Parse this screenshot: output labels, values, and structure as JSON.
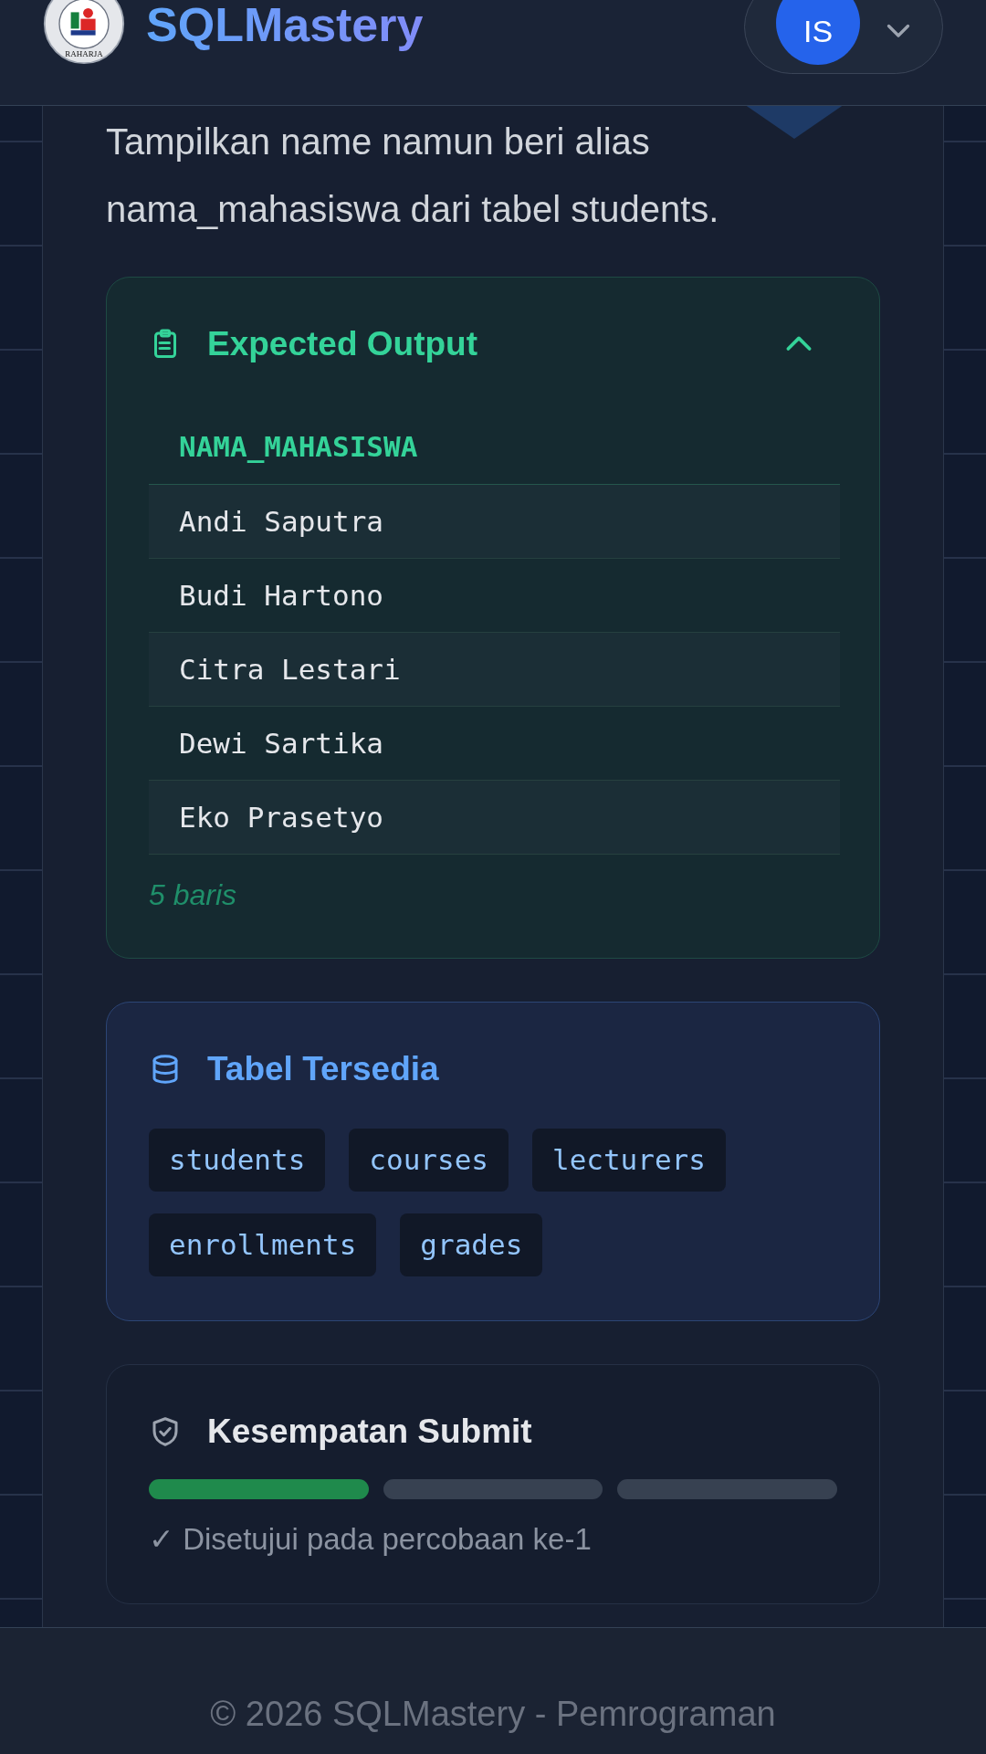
{
  "header": {
    "logo_text": "RAHARJA",
    "title": "SQLMastery",
    "user_initials": "IS"
  },
  "task": {
    "description_lines": [
      "Tampilkan name namun beri alias",
      "nama_mahasiswa dari tabel students."
    ]
  },
  "expected_output": {
    "title": "Expected Output",
    "expanded": true,
    "column": "NAMA_MAHASISWA",
    "rows": [
      "Andi Saputra",
      "Budi Hartono",
      "Citra Lestari",
      "Dewi Sartika",
      "Eko Prasetyo"
    ],
    "row_count": "5 baris"
  },
  "tables": {
    "title": "Tabel Tersedia",
    "items": [
      "students",
      "courses",
      "lecturers",
      "enrollments",
      "grades"
    ]
  },
  "submit": {
    "title": "Kesempatan Submit",
    "attempts": [
      {
        "passed": true
      },
      {
        "passed": false
      },
      {
        "passed": false
      }
    ],
    "status": "✓ Disetujui pada percobaan ke-1"
  },
  "footer": {
    "text": "© 2026 SQLMastery - Pemrograman"
  }
}
